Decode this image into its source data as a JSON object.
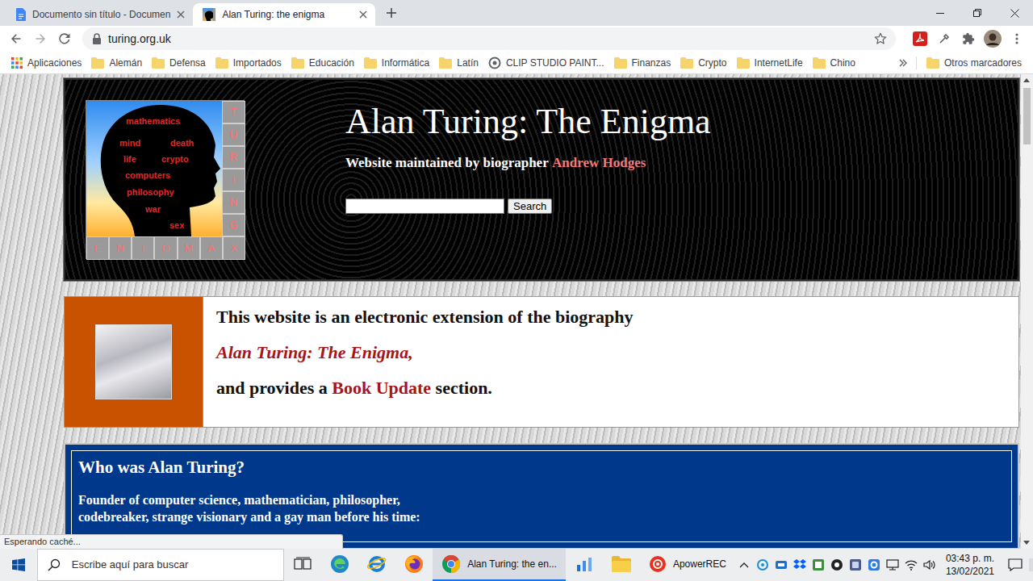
{
  "tabs": [
    {
      "label": "Documento sin título - Documen",
      "selected": false,
      "kind": "docs"
    },
    {
      "label": "Alan Turing: the enigma",
      "selected": true,
      "kind": "site"
    }
  ],
  "toolbar": {
    "url": "turing.org.uk"
  },
  "bookmarks": {
    "items": [
      {
        "label": "Aplicaciones",
        "kind": "apps"
      },
      {
        "label": "Alemán",
        "kind": "folder"
      },
      {
        "label": "Defensa",
        "kind": "folder"
      },
      {
        "label": "Importados",
        "kind": "folder"
      },
      {
        "label": "Educación",
        "kind": "folder"
      },
      {
        "label": "Informática",
        "kind": "folder"
      },
      {
        "label": "Latín",
        "kind": "folder"
      },
      {
        "label": "CLIP STUDIO PAINT...",
        "kind": "site"
      },
      {
        "label": "Finanzas",
        "kind": "folder"
      },
      {
        "label": "Crypto",
        "kind": "folder"
      },
      {
        "label": "InternetLife",
        "kind": "folder"
      },
      {
        "label": "Chino",
        "kind": "folder"
      }
    ],
    "other": "Otros marcadores"
  },
  "status_bubble": "Esperando caché...",
  "page": {
    "logo": {
      "words": [
        "mathematics",
        "mind",
        "death",
        "life",
        "crypto",
        "computers",
        "philosophy",
        "war",
        "sex"
      ],
      "column": [
        "T",
        "U",
        "R",
        "I",
        "N",
        "G"
      ],
      "row": [
        "E",
        "N",
        "I",
        "G",
        "M",
        "A",
        "X"
      ]
    },
    "title": "Alan Turing: The Enigma",
    "maintained_by": "Website maintained by biographer",
    "author": "Andrew Hodges",
    "search_button": "Search",
    "intro": {
      "line1": "This website is an electronic extension of the biography",
      "book": "Alan Turing: The Enigma,",
      "before_link": "and provides a",
      "link": "Book Update",
      "after_link": "section."
    },
    "who": {
      "heading": "Who was Alan Turing?",
      "text": "Founder of computer science, mathematician, philosopher, codebreaker, strange visionary and a gay man before his time:"
    }
  },
  "taskbar": {
    "search_placeholder": "Escribe aquí para buscar",
    "apps": [
      {
        "kind": "taskview",
        "selected": false
      },
      {
        "kind": "edge",
        "selected": false
      },
      {
        "kind": "ie",
        "selected": false
      },
      {
        "kind": "firefox",
        "selected": false
      },
      {
        "kind": "chrome",
        "label": "Alan Turing: the en...",
        "selected": true
      },
      {
        "kind": "bars",
        "selected": false
      },
      {
        "kind": "folder",
        "selected": false
      },
      {
        "kind": "apower",
        "label": "ApowerREC",
        "selected": false
      }
    ],
    "time": "03:43 p. m.",
    "date": "13/02/2021"
  }
}
